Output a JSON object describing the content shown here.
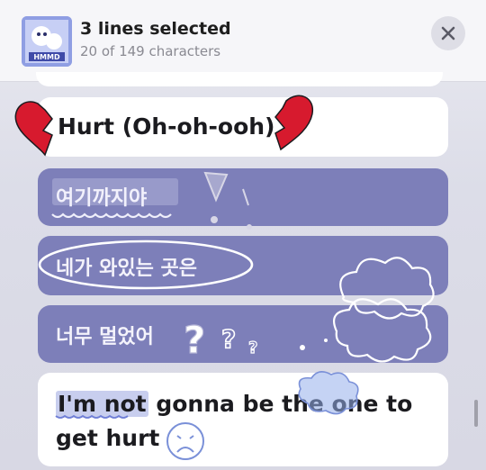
{
  "header": {
    "title": "3 lines selected",
    "subtitle": "20 of 149 characters"
  },
  "lyrics": [
    {
      "text": "Hurt (Oh-oh-ooh)",
      "selected": false
    },
    {
      "text": "여기까지야",
      "selected": true
    },
    {
      "text": "네가 와있는 곳은",
      "selected": true
    },
    {
      "text": "너무 멀었어",
      "selected": true
    },
    {
      "parts": [
        "I'm not",
        " gonna be the one to",
        "get hurt"
      ],
      "selected": false
    }
  ],
  "colors": {
    "accent_selected": "#7d7fb9",
    "heart": "#d71a2e"
  }
}
